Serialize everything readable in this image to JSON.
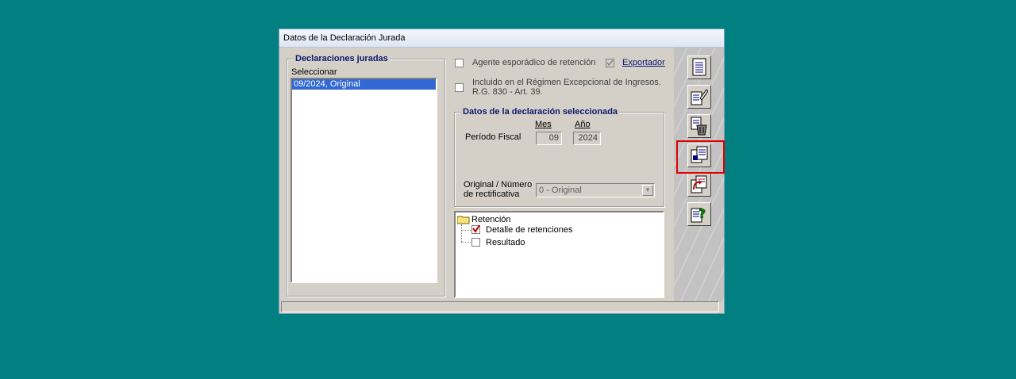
{
  "window": {
    "title": "Datos de la Declaración Jurada"
  },
  "declaraciones": {
    "legend": "Declaraciones juradas",
    "select_label": "Seleccionar",
    "items": [
      "09/2024, Original"
    ]
  },
  "options": {
    "agente_esporadico": {
      "label": "Agente esporádico de retención",
      "checked": false
    },
    "exportador": {
      "label": "Exportador",
      "checked": true
    },
    "regimen_excepcional": {
      "label_line1": "Incluido en el Régimen Excepcional de Ingresos.",
      "label_line2": "R.G. 830 - Art. 39.",
      "checked": false
    }
  },
  "seleccionada": {
    "legend": "Datos de la declaración seleccionada",
    "mes_label": "Mes",
    "anio_label": "Año",
    "periodo_label": "Período Fiscal",
    "mes_value": "09",
    "anio_value": "2024",
    "original_label_line1": "Original / Número",
    "original_label_line2": "de rectificativa",
    "original_value": "0 - Original"
  },
  "tree": {
    "root": "Retención",
    "children": [
      {
        "label": "Detalle de retenciones",
        "checked": true
      },
      {
        "label": "Resultado",
        "checked": false
      }
    ]
  },
  "toolbar": {
    "buttons": [
      "new-document-icon",
      "edit-document-icon",
      "delete-document-icon",
      "copy-document-icon",
      "export-document-icon",
      "help-document-icon"
    ]
  },
  "colors": {
    "desktop": "#008080",
    "selection": "#3168d4",
    "legend_text": "#0a1a6e",
    "highlight": "#e00000"
  }
}
